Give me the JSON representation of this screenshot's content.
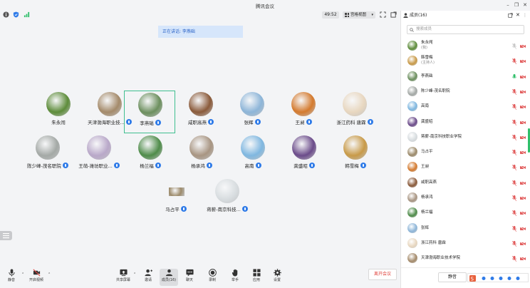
{
  "window": {
    "title": "腾讯会议",
    "controls": [
      "minimize-icon",
      "restore-icon",
      "close-icon"
    ]
  },
  "topbar": {
    "timer": "49:52",
    "view_label": "宫格视图",
    "icons": [
      "info-icon",
      "shield-icon",
      "signal-icon",
      "fullscreen-icon",
      "popout-icon"
    ]
  },
  "speaking": {
    "text": "正在讲话: 李燕础"
  },
  "participants": [
    {
      "name": "朱永闯",
      "mic": false,
      "color": "#5d8c3a"
    },
    {
      "name": "天津渤海职业技...",
      "mic": true,
      "color": "#a48a6a"
    },
    {
      "name": "李燕础",
      "mic": true,
      "active": true,
      "color": "#6c8f5e"
    },
    {
      "name": "咸职高燕",
      "mic": true,
      "color": "#8a5a3a"
    },
    {
      "name": "张辉",
      "mic": true,
      "color": "#8db5d8"
    },
    {
      "name": "王昶",
      "mic": true,
      "color": "#d47a2e"
    },
    {
      "name": "浙江药科 唐霖",
      "mic": true,
      "color": "#e8d7c0"
    },
    {
      "name": "陈少峰-茂名职院",
      "mic": true,
      "color": "#a4a9a6"
    },
    {
      "name": "王萌-潍坊职业...",
      "mic": true,
      "color": "#b9a8c9"
    },
    {
      "name": "杨兰福",
      "mic": true,
      "color": "#4f8c4a"
    },
    {
      "name": "杨承鸿",
      "mic": true,
      "color": "#a89582"
    },
    {
      "name": "高南",
      "mic": true,
      "color": "#7fb7e0"
    },
    {
      "name": "龚盛昭",
      "mic": true,
      "color": "#6b4b8a"
    },
    {
      "name": "韩雪梅",
      "mic": true,
      "color": "#c89a48"
    },
    {
      "name": "马占平",
      "mic": true,
      "color": "#9c8a6a",
      "rect": true
    },
    {
      "name": "蒋薪-南京科技...",
      "mic": true,
      "color": "#d8dde0"
    }
  ],
  "bottombar": {
    "items": [
      {
        "label": "静音",
        "icon": "microphone-icon"
      },
      {
        "label": "开启视频",
        "icon": "camera-off-icon"
      },
      {
        "label": "共享屏幕",
        "icon": "share-screen-icon"
      },
      {
        "label": "邀请",
        "icon": "invite-icon"
      },
      {
        "label": "成员(16)",
        "icon": "members-icon"
      },
      {
        "label": "聊天",
        "icon": "chat-icon"
      },
      {
        "label": "录制",
        "icon": "record-icon"
      },
      {
        "label": "举手",
        "icon": "raise-hand-icon"
      },
      {
        "label": "应用",
        "icon": "apps-icon"
      },
      {
        "label": "设置",
        "icon": "settings-icon"
      }
    ],
    "leave_label": "离开会议"
  },
  "panel": {
    "title": "成员(16)",
    "search_placeholder": "搜索成员",
    "mute_all_label": "静音",
    "members": [
      {
        "name": "朱永闯",
        "sub": "(我)",
        "color": "#5d8c3a"
      },
      {
        "name": "韩雪梅",
        "sub": "(主持人)",
        "color": "#c89a48"
      },
      {
        "name": "李燕础",
        "sub": "",
        "color": "#6c8f5e",
        "speaking": true
      },
      {
        "name": "陈少峰-茂名职院",
        "sub": "",
        "color": "#a4a9a6"
      },
      {
        "name": "高南",
        "sub": "",
        "color": "#7fb7e0"
      },
      {
        "name": "龚盛昭",
        "sub": "",
        "color": "#6b4b8a"
      },
      {
        "name": "蒋薪-南京科技职业学院",
        "sub": "",
        "color": "#d8dde0"
      },
      {
        "name": "马占平",
        "sub": "",
        "color": "#9c8a6a"
      },
      {
        "name": "王昶",
        "sub": "",
        "color": "#d47a2e"
      },
      {
        "name": "咸职高燕",
        "sub": "",
        "color": "#8a5a3a"
      },
      {
        "name": "杨承鸿",
        "sub": "",
        "color": "#a89582"
      },
      {
        "name": "杨兰福",
        "sub": "",
        "color": "#4f8c4a"
      },
      {
        "name": "张辉",
        "sub": "",
        "color": "#8db5d8"
      },
      {
        "name": "浙江药科 唐霖",
        "sub": "",
        "color": "#e8d7c0"
      },
      {
        "name": "天津渤海职业技术学院",
        "sub": "",
        "color": "#a48a6a"
      }
    ]
  },
  "colors": {
    "accent": "#2f7be8",
    "active_border": "#3fbf8f",
    "leave": "#e0443e",
    "muted_mic": "#e25c5c",
    "speaking_mic": "#2fbf6a"
  }
}
